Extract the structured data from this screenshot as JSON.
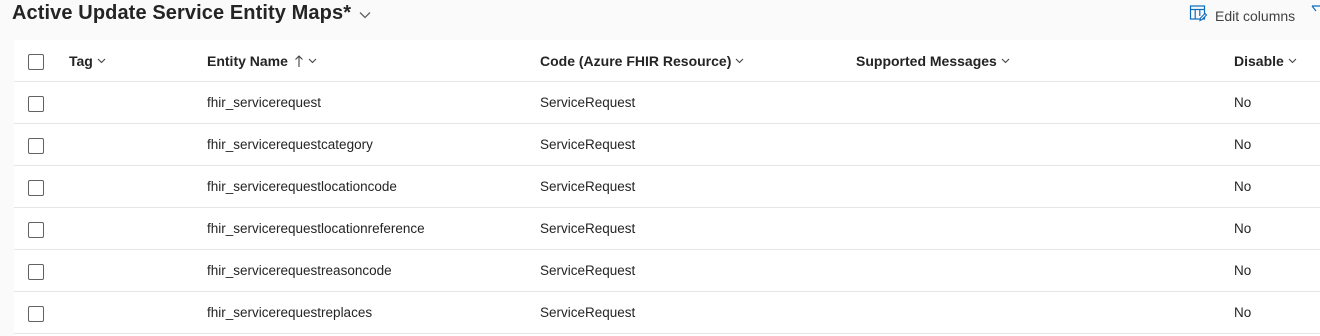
{
  "view": {
    "title": "Active Update Service Entity Maps*"
  },
  "toolbar": {
    "edit_columns_label": "Edit columns"
  },
  "grid": {
    "columns": {
      "tag": "Tag",
      "entity_name": "Entity Name",
      "code": "Code (Azure FHIR Resource)",
      "supported_messages": "Supported Messages",
      "disable": "Disable"
    },
    "sort": {
      "column": "Entity Name",
      "direction": "ascending"
    },
    "rows": [
      {
        "tag": "",
        "entity_name": "fhir_servicerequest",
        "code": "ServiceRequest",
        "supported_messages": "",
        "disable": "No"
      },
      {
        "tag": "",
        "entity_name": "fhir_servicerequestcategory",
        "code": "ServiceRequest",
        "supported_messages": "",
        "disable": "No"
      },
      {
        "tag": "",
        "entity_name": "fhir_servicerequestlocationcode",
        "code": "ServiceRequest",
        "supported_messages": "",
        "disable": "No"
      },
      {
        "tag": "",
        "entity_name": "fhir_servicerequestlocationreference",
        "code": "ServiceRequest",
        "supported_messages": "",
        "disable": "No"
      },
      {
        "tag": "",
        "entity_name": "fhir_servicerequestreasoncode",
        "code": "ServiceRequest",
        "supported_messages": "",
        "disable": "No"
      },
      {
        "tag": "",
        "entity_name": "fhir_servicerequestreplaces",
        "code": "ServiceRequest",
        "supported_messages": "",
        "disable": "No"
      }
    ]
  },
  "colors": {
    "page_bg": "#fafafa",
    "grid_bg": "#ffffff",
    "text": "#242424",
    "accent_icon": "#0f6cbd",
    "divider": "#e6e6e6"
  }
}
